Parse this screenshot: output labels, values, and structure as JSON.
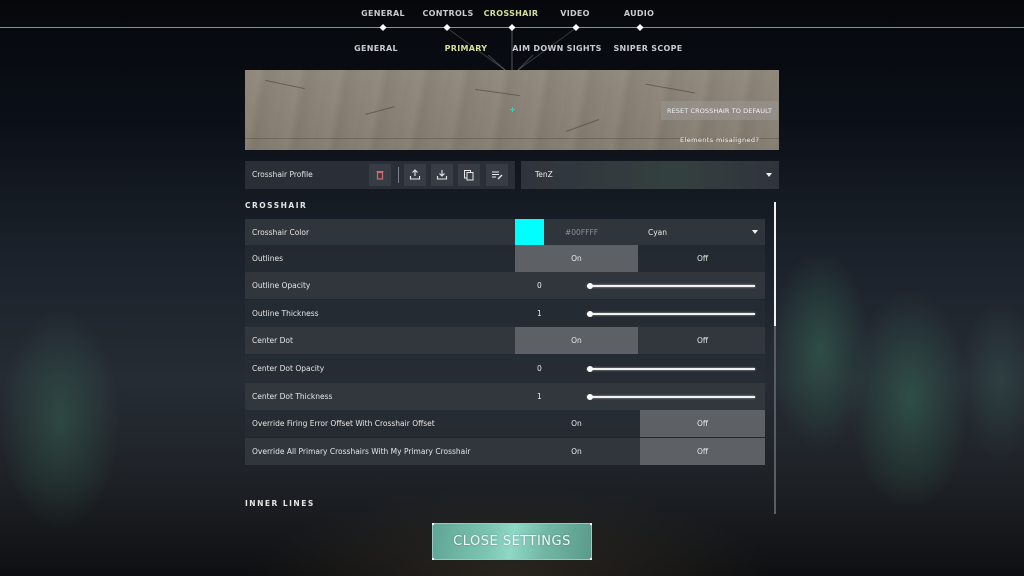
{
  "top_tabs": [
    {
      "label": "GENERAL",
      "active": false
    },
    {
      "label": "CONTROLS",
      "active": false
    },
    {
      "label": "CROSSHAIR",
      "active": true
    },
    {
      "label": "VIDEO",
      "active": false
    },
    {
      "label": "AUDIO",
      "active": false
    }
  ],
  "sub_tabs": [
    {
      "label": "GENERAL",
      "active": false
    },
    {
      "label": "PRIMARY",
      "active": true
    },
    {
      "label": "AIM DOWN SIGHTS",
      "active": false
    },
    {
      "label": "SNIPER SCOPE",
      "active": false
    }
  ],
  "preview": {
    "reset_label": "RESET CROSSHAIR TO DEFAULT",
    "misaligned_label": "Elements misaligned?"
  },
  "profile": {
    "label": "Crosshair Profile",
    "selected": "TenZ",
    "icons": [
      "trash-icon",
      "upload-icon",
      "download-icon",
      "copy-icon",
      "rename-icon"
    ]
  },
  "sections": {
    "crosshair_title": "CROSSHAIR",
    "inner_lines_title": "INNER LINES"
  },
  "settings": {
    "crosshair_color": {
      "label": "Crosshair Color",
      "hex": "#00FFFF",
      "swatch": "#00FFFF",
      "selected": "Cyan"
    },
    "outlines": {
      "label": "Outlines",
      "on": "On",
      "off": "Off",
      "value": "on"
    },
    "outline_opacity": {
      "label": "Outline Opacity",
      "value": "0",
      "fraction": 0
    },
    "outline_thickness": {
      "label": "Outline Thickness",
      "value": "1",
      "fraction": 0
    },
    "center_dot": {
      "label": "Center Dot",
      "on": "On",
      "off": "Off",
      "value": "on"
    },
    "center_dot_opacity": {
      "label": "Center Dot Opacity",
      "value": "0",
      "fraction": 0
    },
    "center_dot_thickness": {
      "label": "Center Dot Thickness",
      "value": "1",
      "fraction": 0
    },
    "override_firing_error": {
      "label": "Override Firing Error Offset With Crosshair Offset",
      "on": "On",
      "off": "Off",
      "value": "off"
    },
    "override_all_primary": {
      "label": "Override All Primary Crosshairs With My Primary Crosshair",
      "on": "On",
      "off": "Off",
      "value": "off"
    }
  },
  "scroll": {
    "position": 0
  },
  "footer": {
    "close_label": "CLOSE SETTINGS"
  },
  "colors": {
    "active_tab": "#d5df9a",
    "accent_button": "#7cc4b2",
    "crosshair": "#00FFFF"
  }
}
